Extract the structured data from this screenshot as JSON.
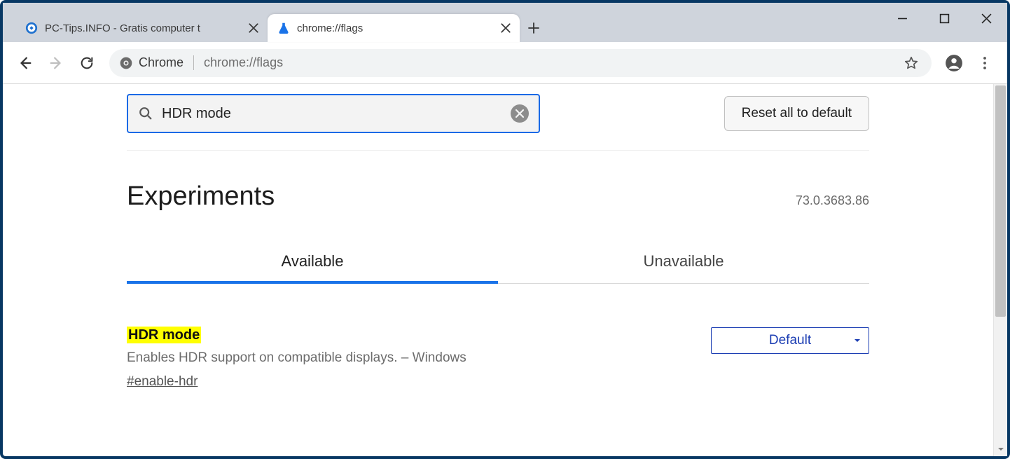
{
  "window": {
    "tabs": [
      {
        "title": "PC-Tips.INFO - Gratis computer t",
        "active": false
      },
      {
        "title": "chrome://flags",
        "active": true
      }
    ]
  },
  "toolbar": {
    "chip_label": "Chrome",
    "url": "chrome://flags"
  },
  "page": {
    "search_value": "HDR mode",
    "reset_label": "Reset all to default",
    "heading": "Experiments",
    "version": "73.0.3683.86",
    "tabs": [
      {
        "label": "Available",
        "active": true
      },
      {
        "label": "Unavailable",
        "active": false
      }
    ],
    "flag": {
      "title": "HDR mode",
      "description": "Enables HDR support on compatible displays. – Windows",
      "hash": "#enable-hdr",
      "dropdown_value": "Default"
    }
  }
}
